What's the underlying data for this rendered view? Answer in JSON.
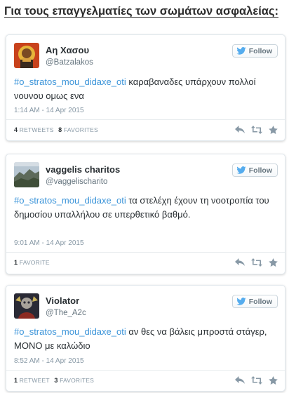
{
  "page": {
    "heading": "Για τους επαγγελματίες των σωμάτων ασφαλείας:"
  },
  "ui": {
    "follow_label": "Follow",
    "retweets_label": "RETWEETS",
    "favorites_label": "FAVORITES",
    "favorite_label_singular": "FAVORITE",
    "retweet_label_singular": "RETWEET",
    "link_color": "#3b94d9",
    "twitter_blue": "#55acee"
  },
  "tweets": [
    {
      "name": "Αη Χασου",
      "handle": "@Batzalakos",
      "hashtag": "#o_stratos_mou_didaxe_oti",
      "text": " καραβαναδες υπάρχουν πολλοί νουνου ομως ενα",
      "time": "1:14 AM - 14 Apr 2015",
      "retweets": "4",
      "retweets_label": "RETWEETS",
      "favorites": "8",
      "favorites_label": "FAVORITES"
    },
    {
      "name": "vaggelis charitos",
      "handle": "@vaggelischarito",
      "hashtag": "#o_stratos_mou_didaxe_oti",
      "text": " τα στελέχη έχουν τη νοοτροπία του δημοσίου υπαλλήλου σε υπερθετικό βαθμό.",
      "time": "9:01 AM - 14 Apr 2015",
      "favorites": "1",
      "favorites_label": "FAVORITE"
    },
    {
      "name": "Violator",
      "handle": "@The_A2c",
      "hashtag": "#o_stratos_mou_didaxe_oti",
      "text": " αν θες να βάλεις μπροστά στάγερ, ΜΟΝΟ με καλώδιο",
      "time": "8:52 AM - 14 Apr 2015",
      "retweets": "1",
      "retweets_label": "RETWEET",
      "favorites": "3",
      "favorites_label": "FAVORITES"
    }
  ]
}
